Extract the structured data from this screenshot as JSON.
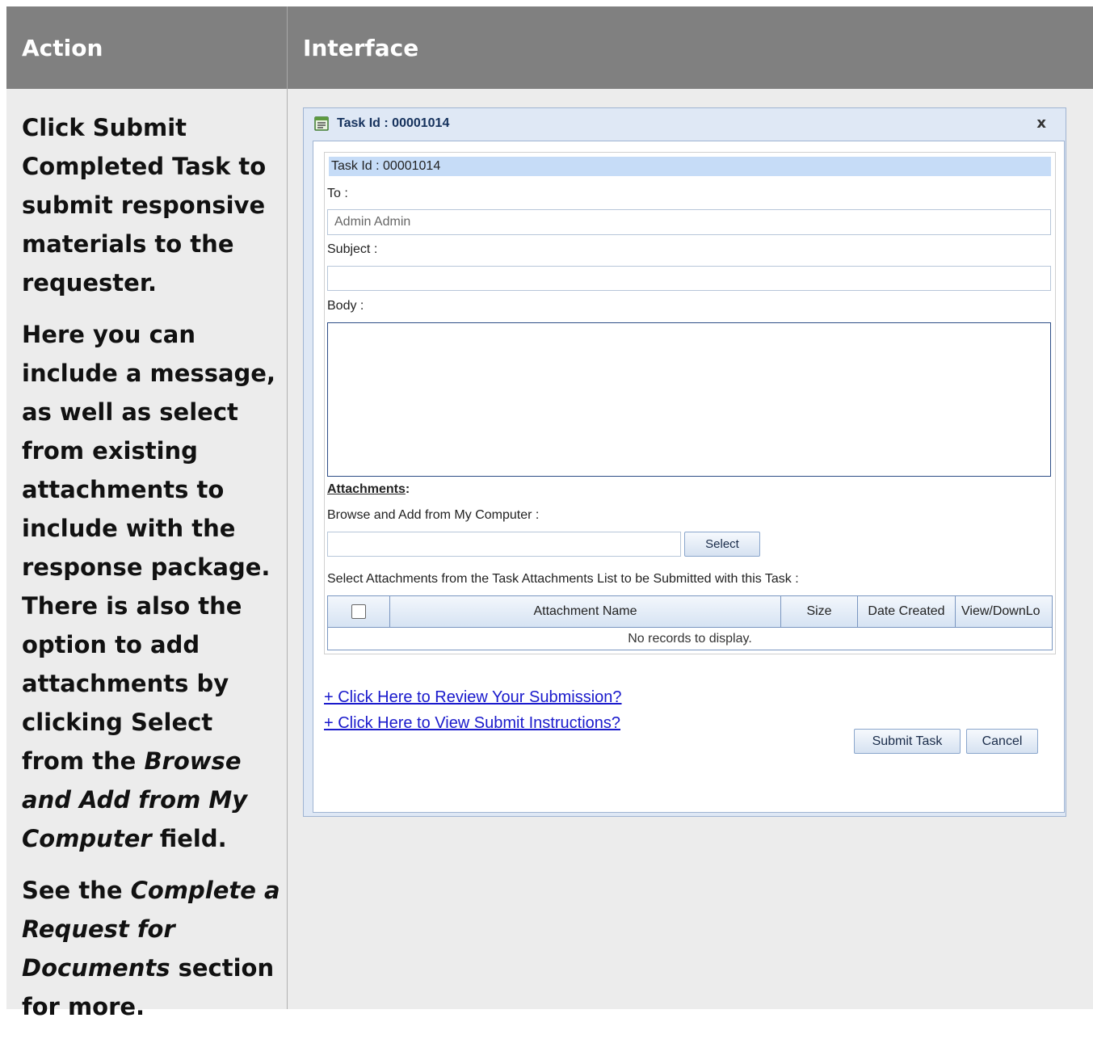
{
  "table": {
    "header_action": "Action",
    "header_interface": "Interface"
  },
  "action": {
    "p1": "Click Submit Completed Task to submit responsive materials to the requester.",
    "p2_a": "Here you can include a message, as well as select from existing attachments to include with the response package. There is also the option to add attachments by clicking Select from the ",
    "p2_em": "Browse and Add from My Computer",
    "p2_b": " field.",
    "p3_a": "See the ",
    "p3_em": "Complete a Request for Documents",
    "p3_b": " section for more."
  },
  "dialog": {
    "title": "Task Id : 00001014",
    "close": "x",
    "panel_header": "Task Id : 00001014",
    "to_label": "To :",
    "to_value": "Admin Admin",
    "subject_label": "Subject :",
    "body_label": "Body :",
    "attachments_label": "Attachments",
    "attachments_colon": ":",
    "browse_label": "Browse and Add from My Computer :",
    "select_button": "Select",
    "select_list_label": "Select Attachments from the Task Attachments List to be Submitted with this Task :",
    "grid_columns": [
      "Attachment Name",
      "Size",
      "Date Created",
      "View/DownLo"
    ],
    "grid_empty": "No records to display.",
    "review_link": "+ Click Here to Review Your Submission?",
    "instructions_link": "+ Click Here to View Submit Instructions?",
    "submit_button": "Submit Task",
    "cancel_button": "Cancel"
  }
}
